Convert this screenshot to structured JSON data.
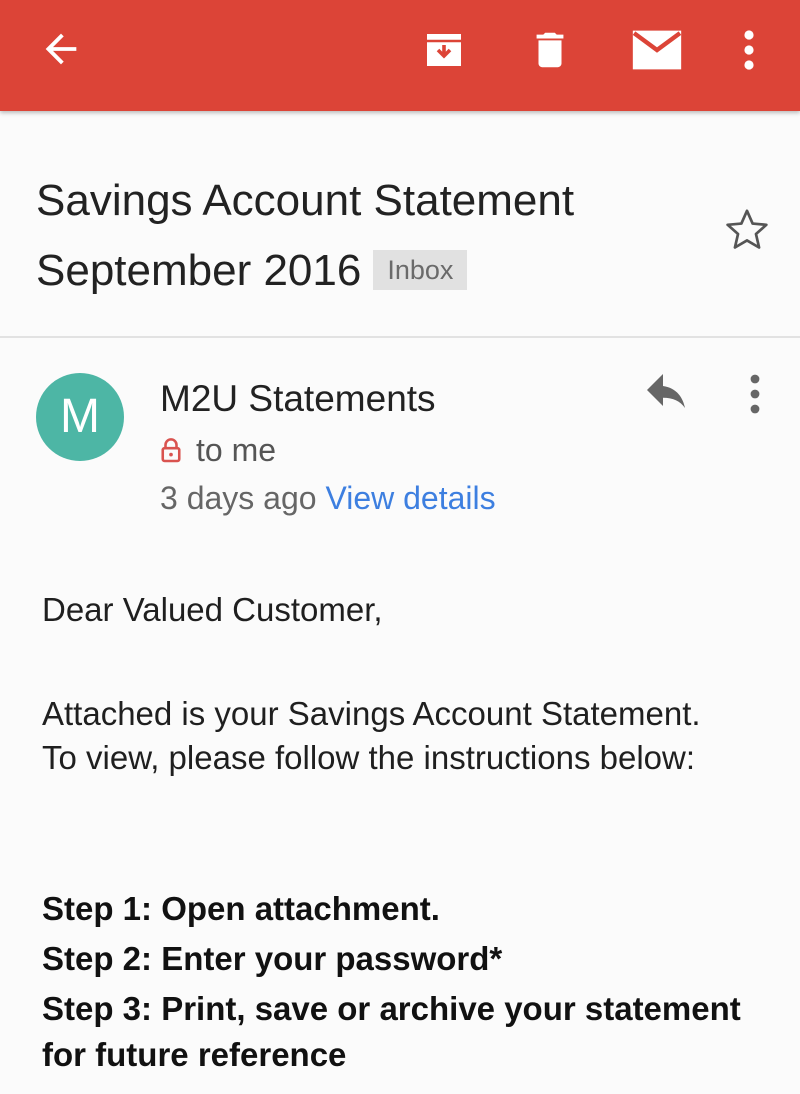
{
  "toolbar": {
    "background": "#dc4437",
    "icons": [
      "back-icon",
      "archive-icon",
      "delete-icon",
      "mark-unread-icon",
      "more-vert-icon"
    ]
  },
  "email": {
    "subject": "Savings Account Statement September 2016",
    "label": "Inbox",
    "starred": false
  },
  "sender": {
    "avatar_letter": "M",
    "avatar_color": "#4db6a5",
    "name": "M2U Statements",
    "recipient": "to me",
    "time": "3 days ago",
    "details_link": "View details"
  },
  "body": {
    "greeting": "Dear Valued Customer,",
    "intro": "Attached is your Savings Account Statement. To view, please follow the instructions below:",
    "steps": [
      "Step 1: Open attachment.",
      "Step 2: Enter your password*",
      "Step 3: Print, save or archive your statement for future reference"
    ]
  }
}
